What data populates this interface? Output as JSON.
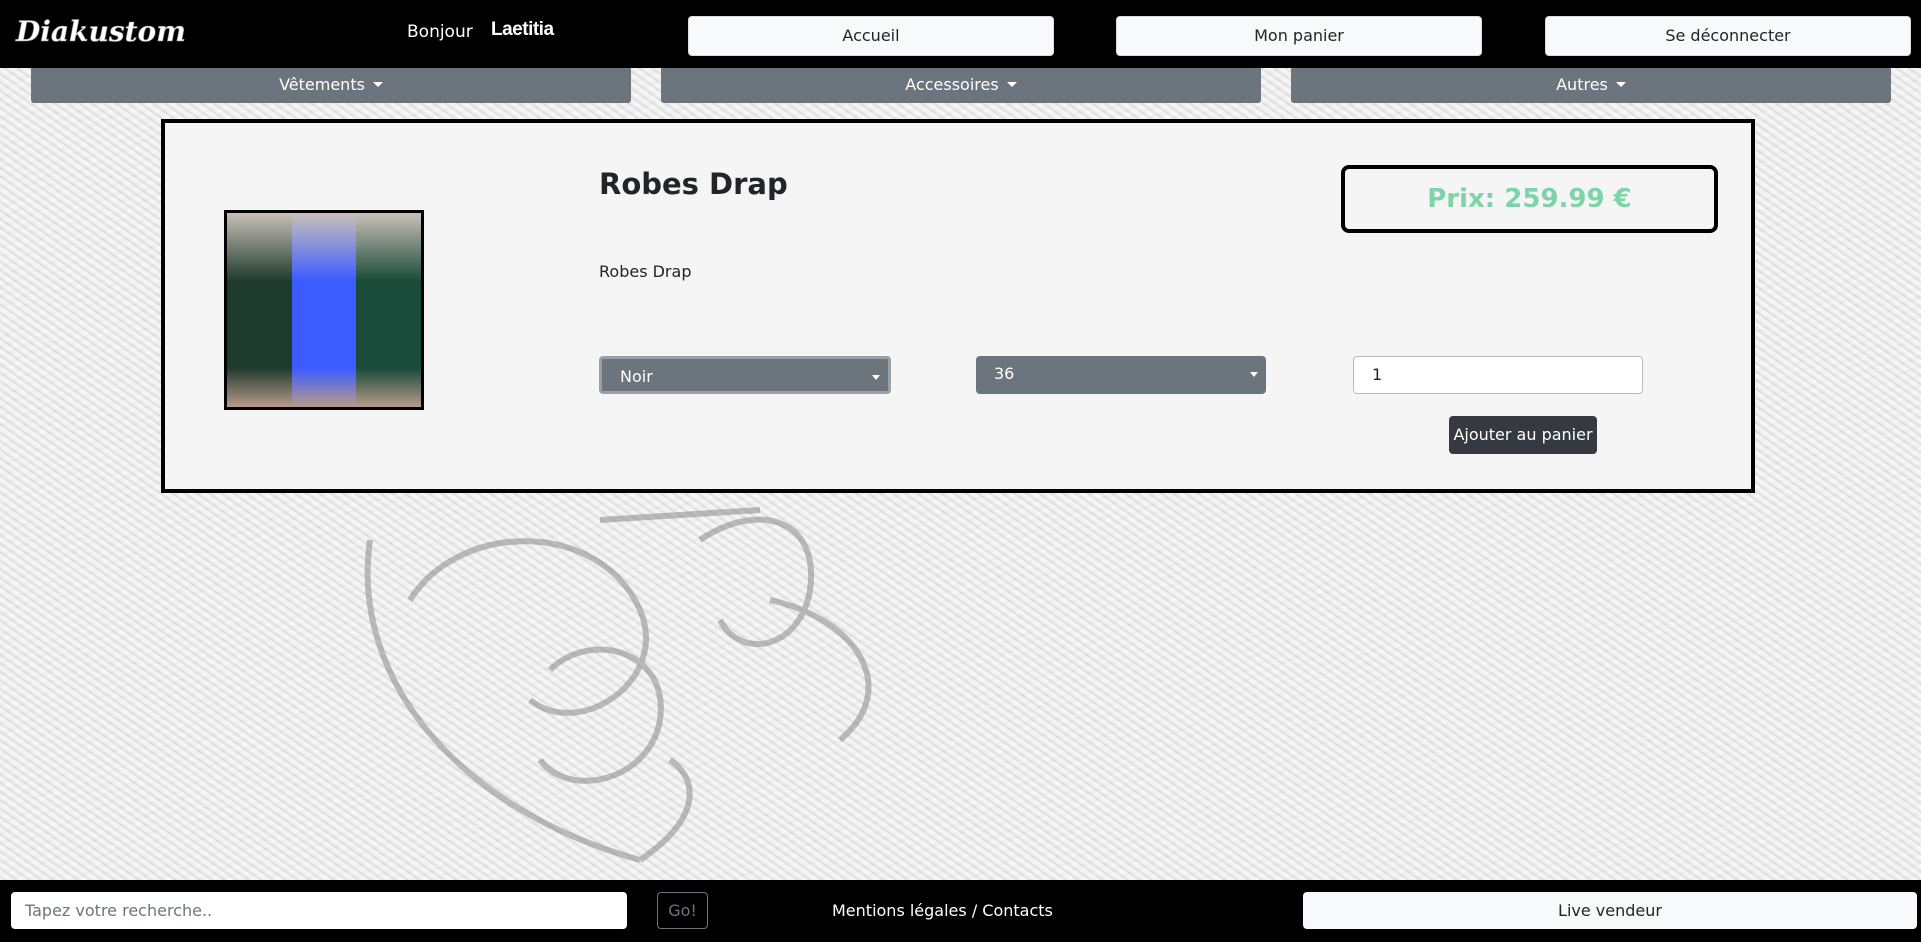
{
  "header": {
    "logo_text": "Diakustom",
    "greeting": "Bonjour",
    "username": "Laetitia",
    "nav": [
      "Accueil",
      "Mon panier",
      "Se déconnecter"
    ]
  },
  "categories": [
    "Vêtements",
    "Accessoires",
    "Autres"
  ],
  "product": {
    "title": "Robes Drap",
    "description": "Robes Drap",
    "price_label": "Prix: 259.99 €",
    "color_selected": "Noir",
    "size_selected": "36",
    "quantity": "1",
    "add_to_cart": "Ajouter au panier",
    "image_colors": [
      "#1f3b2e",
      "#3b5cff",
      "#1b4b3a"
    ]
  },
  "footer": {
    "search_placeholder": "Tapez votre recherche..",
    "go": "Go!",
    "legal": "Mentions légales / Contacts",
    "live": "Live vendeur"
  },
  "colors": {
    "price": "#7ed3a8",
    "category_bg": "#6c757d",
    "button_dark": "#343a40"
  }
}
